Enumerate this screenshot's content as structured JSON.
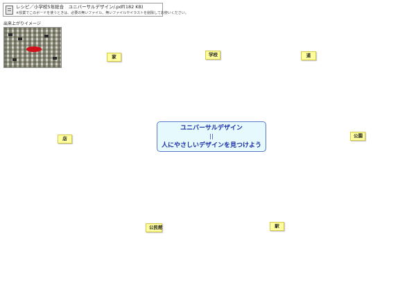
{
  "attachment": {
    "icon": "document-icon",
    "file_name": "レシピ／小学校5年総合　ユニバーサルデザイン/.pdf(182 KB)",
    "note": "※授業でこのボードを使うときは、必要の無いファイル、無いファイルやイラストを削除してお使いください。"
  },
  "preview": {
    "label": "出来上がりイメージ"
  },
  "center": {
    "line1": "ユニバーサルデザイン",
    "separator": "||",
    "line2": "人にやさしいデザインを見つけよう",
    "border_color": "#5a78c8",
    "background_color": "#e6f9fd",
    "text_color": "#1a2ea8"
  },
  "words": [
    {
      "id": "ie",
      "label": "家"
    },
    {
      "id": "gakkou",
      "label": "学校"
    },
    {
      "id": "michi",
      "label": "道"
    },
    {
      "id": "mise",
      "label": "店"
    },
    {
      "id": "kouen",
      "label": "公園"
    },
    {
      "id": "kouminkan",
      "label": "公民館"
    },
    {
      "id": "eki",
      "label": "駅"
    }
  ],
  "card_color": "#ffffa0"
}
